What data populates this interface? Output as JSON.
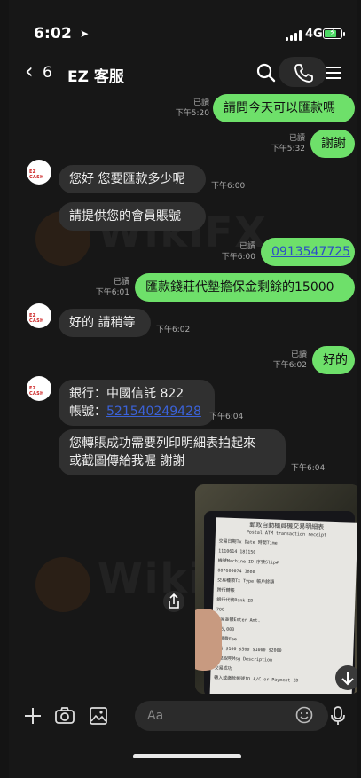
{
  "status": {
    "time": "6:02",
    "network": "4G"
  },
  "header": {
    "back_count": "6",
    "title": "EZ 客服"
  },
  "avatar_text": "EZ CASH",
  "messages": {
    "m1": {
      "text": "請問今天可以匯款嗎",
      "read": "已讀",
      "time": "下午5:20"
    },
    "m2": {
      "text": "謝謝",
      "read": "已讀",
      "time": "下午5:32"
    },
    "m3": {
      "text": "您好 您要匯款多少呢"
    },
    "m4": {
      "text": "請提供您的會員賬號",
      "time": "下午6:00"
    },
    "m5": {
      "text": "0913547725",
      "read": "已讀",
      "time": "下午6:00"
    },
    "m6": {
      "text": "匯款錢莊代墊擔保金剩餘的15000",
      "read": "已讀",
      "time": "下午6:01"
    },
    "m7": {
      "text": "好的 請稍等",
      "time": "下午6:02"
    },
    "m8": {
      "text": "好的",
      "read": "已讀",
      "time": "下午6:02"
    },
    "m9": {
      "line1": "銀行：中國信託 822",
      "line2_label": "帳號：",
      "account": "521540249428",
      "time": "下午6:04"
    },
    "m10": {
      "line1": "您轉賬成功需要列印明細表拍起來",
      "line2": "或截圖傳給我喔 謝謝",
      "time": "下午6:04"
    }
  },
  "receipt": {
    "title": "郵政自動櫃員機交易明細表",
    "subtitle": "Postal ATM transaction receipt",
    "rows": [
      "交易日期Tx Date   時間Time",
      "1110614          181150",
      "機號Machine ID   序號Slip#",
      "007600074        1888",
      "交易種類Tx Type  帳戶餘額",
      "跨行轉帳",
      "銀行代號Bank ID",
      "700",
      "交易金額Enter Amt.",
      "$15,000",
      "手續費Fee",
      "$15         $100 $500 $1000 $2000",
      "訊息說明Msg Description",
      "交易成功",
      "轉入或繳款帳號ID A/C or Payment ID"
    ]
  },
  "watermark": "WikiFX",
  "input": {
    "placeholder": "Aa"
  },
  "colors": {
    "me_bubble": "#6ee06a",
    "them_bubble": "#303030",
    "link": "#3b62d8"
  }
}
